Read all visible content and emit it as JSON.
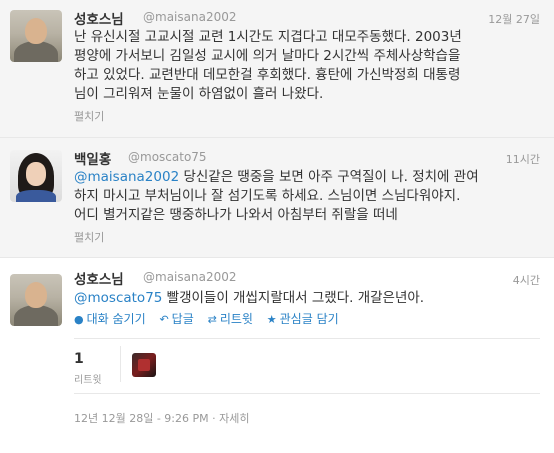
{
  "tweets": [
    {
      "name": "성호스님",
      "handle": "@maisana2002",
      "time": "12월 27일",
      "lines": [
        "난 유신시절 고교시절 교련 1시간도 지겹다고 대모주동했다. 2003년",
        "평양에 가서보니 김일성 교시에 의거 날마다 2시간씩 주체사상학습을",
        "하고 있었다. 교련반대 데모한걸 후회했다. 흉탄에 가신박정희 대통령",
        "님이 그리워져 눈물이 하염없이 흘러 나왔다."
      ],
      "expand": "펼치기"
    },
    {
      "name": "백일홍",
      "handle": "@moscato75",
      "time": "11시간",
      "mention": "@maisana2002",
      "lines": [
        " 당신같은 땡중을 보면 아주 구역질이 나. 정치에 관여",
        "하지 마시고 부처님이나 잘 섬기도록 하세요. 스님이면 스님다워야지.",
        "어디 별거지같은 땡중하나가 나와서 아침부터 쥐랄을 떠네"
      ],
      "expand": "펼치기"
    },
    {
      "name": "성호스님",
      "handle": "@maisana2002",
      "time": "4시간",
      "mention": "@moscato75",
      "text": " 빨갱이들이 개씹지랄대서 그랬다. 개갈은년아.",
      "actions": {
        "conversation": "대화 숨기기",
        "reply": "답글",
        "retweet": "리트윗",
        "favorite": "관심글 담기"
      },
      "retweet_count": "1",
      "retweet_label": "리트윗",
      "meta": "12년 12월 28일 - 9:26 PM · 자세히"
    }
  ]
}
